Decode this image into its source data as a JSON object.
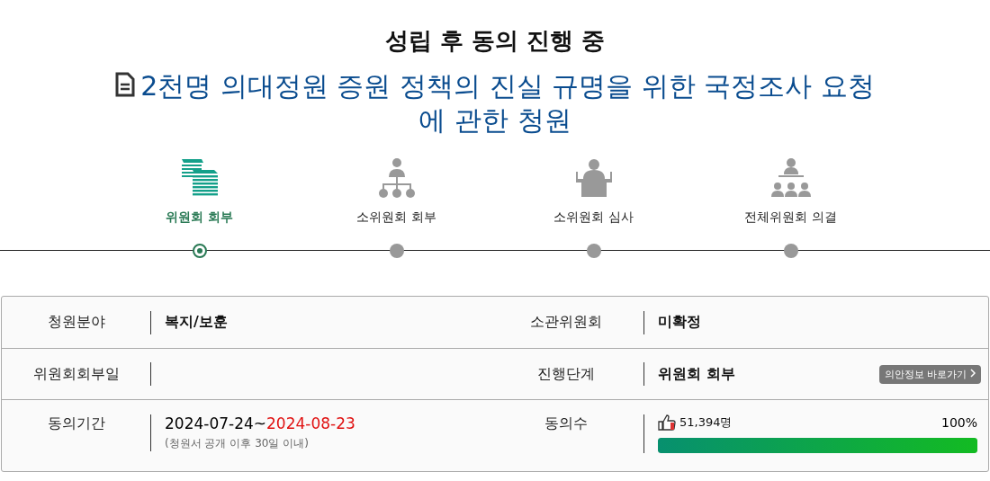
{
  "status": "성립 후 동의 진행 중",
  "title": "2천명 의대정원 증원 정책의 진실 규명을 위한 국정조사 요청에 관한 청원",
  "steps": [
    {
      "label": "위원회 회부",
      "selected": true
    },
    {
      "label": "소위원회 회부",
      "selected": false
    },
    {
      "label": "소위원회 심사",
      "selected": false
    },
    {
      "label": "전체위원회 의결",
      "selected": false
    }
  ],
  "info": {
    "field_label": "청원분야",
    "field": "복지/보훈",
    "committee_label": "소관위원회",
    "committee": "미확정",
    "referral_label": "위원회회부일",
    "stage_label": "진행단계",
    "stage": "위원회 회부",
    "bill_link": "의안정보 바로가기",
    "period_label": "동의기간",
    "period_start": "2024-07-24~",
    "period_end": "2024-08-23",
    "period_note": "(청원서 공개 이후 30일 이내)",
    "agree_label": "동의수",
    "agree_count": "51,394명",
    "agree_percent": "100%",
    "level": 1
  }
}
